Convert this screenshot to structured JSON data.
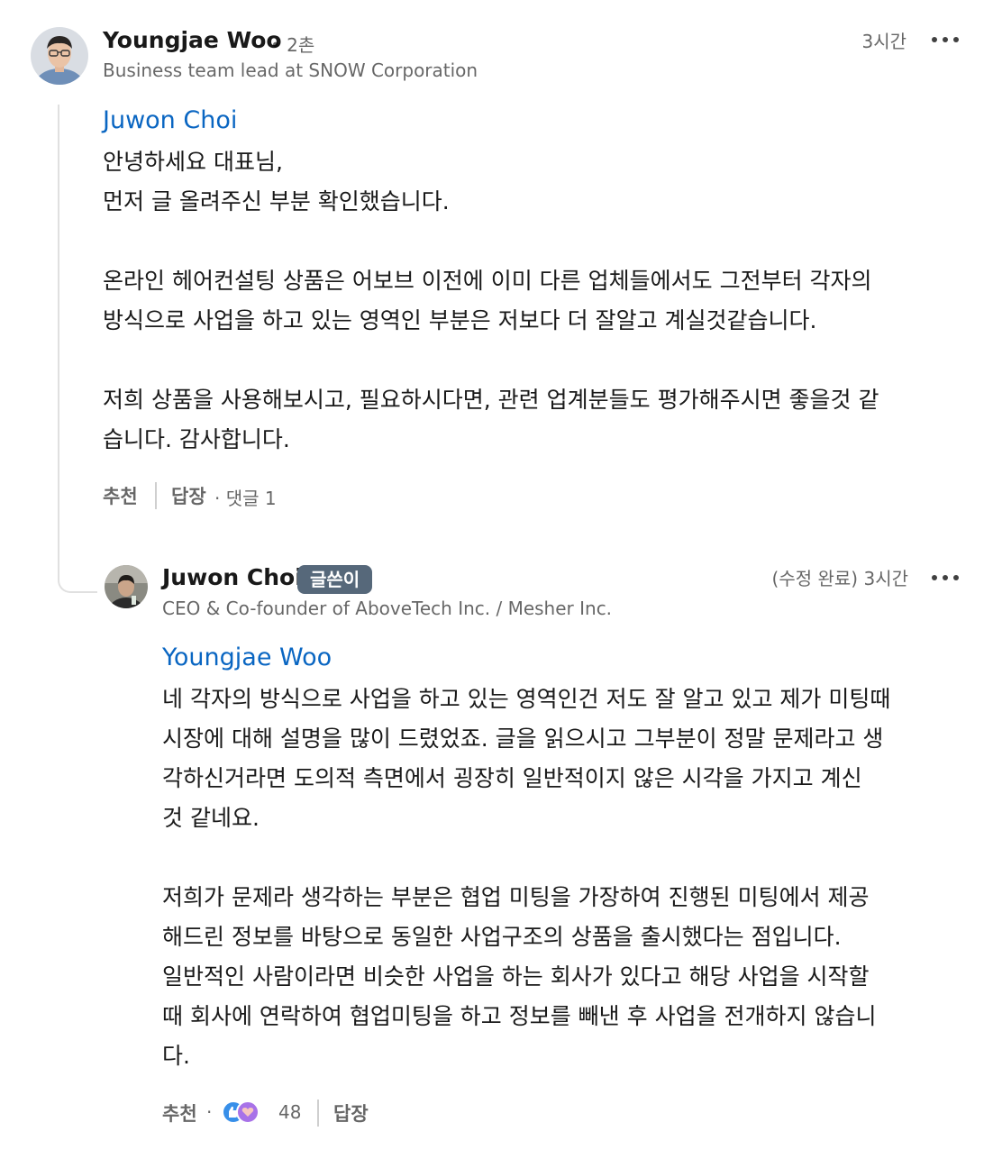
{
  "comment1": {
    "author": "Youngjae Woo",
    "degree": "• 2촌",
    "headline": "Business team lead at SNOW Corporation",
    "time": "3시간",
    "mention": "Juwon Choi",
    "body": "안녕하세요 대표님,\n먼저 글 올려주신 부분 확인했습니다.\n\n온라인 헤어컨설팅 상품은 어보브 이전에 이미 다른 업체들에서도 그전부터 각자의\n방식으로 사업을 하고 있는 영역인 부분은 저보다 더 잘알고 계실것같습니다.\n\n저희 상품을 사용해보시고, 필요하시다면, 관련 업계분들도 평가해주시면 좋을것 같\n습니다. 감사합니다.",
    "like_label": "추천",
    "reply_label": "답장",
    "reply_count": "· 댓글 1"
  },
  "comment2": {
    "author": "Juwon Choi",
    "badge": "글쓴이",
    "headline": "CEO & Co-founder of AboveTech Inc. / Mesher Inc.",
    "time": "(수정 완료) 3시간",
    "mention": "Youngjae Woo",
    "body": "네 각자의 방식으로 사업을 하고 있는 영역인건 저도 잘 알고 있고 제가 미팅때\n시장에 대해 설명을 많이 드렸었죠. 글을 읽으시고 그부분이 정말 문제라고 생\n각하신거라면 도의적 측면에서 굉장히 일반적이지 않은 시각을 가지고 계신\n것 같네요.\n\n저희가 문제라 생각하는 부분은 협업 미팅을 가장하여 진행된 미팅에서 제공\n해드린 정보를 바탕으로 동일한 사업구조의 상품을 출시했다는 점입니다.\n일반적인 사람이라면 비슷한 사업을 하는 회사가 있다고 해당 사업을 시작할\n때 회사에 연락하여 협업미팅을 하고 정보를 빼낸 후 사업을 전개하지 않습니\n다.",
    "like_label": "추천",
    "dot": "·",
    "reaction_count": "48",
    "reply_label": "답장",
    "reaction_icons": [
      "like-icon",
      "support-icon"
    ]
  },
  "colors": {
    "mention": "#0a66c2",
    "badge_bg": "#56687a",
    "like": "#378fe9",
    "support": "#a872e8"
  },
  "icons": {
    "more": "ellipsis-icon"
  }
}
